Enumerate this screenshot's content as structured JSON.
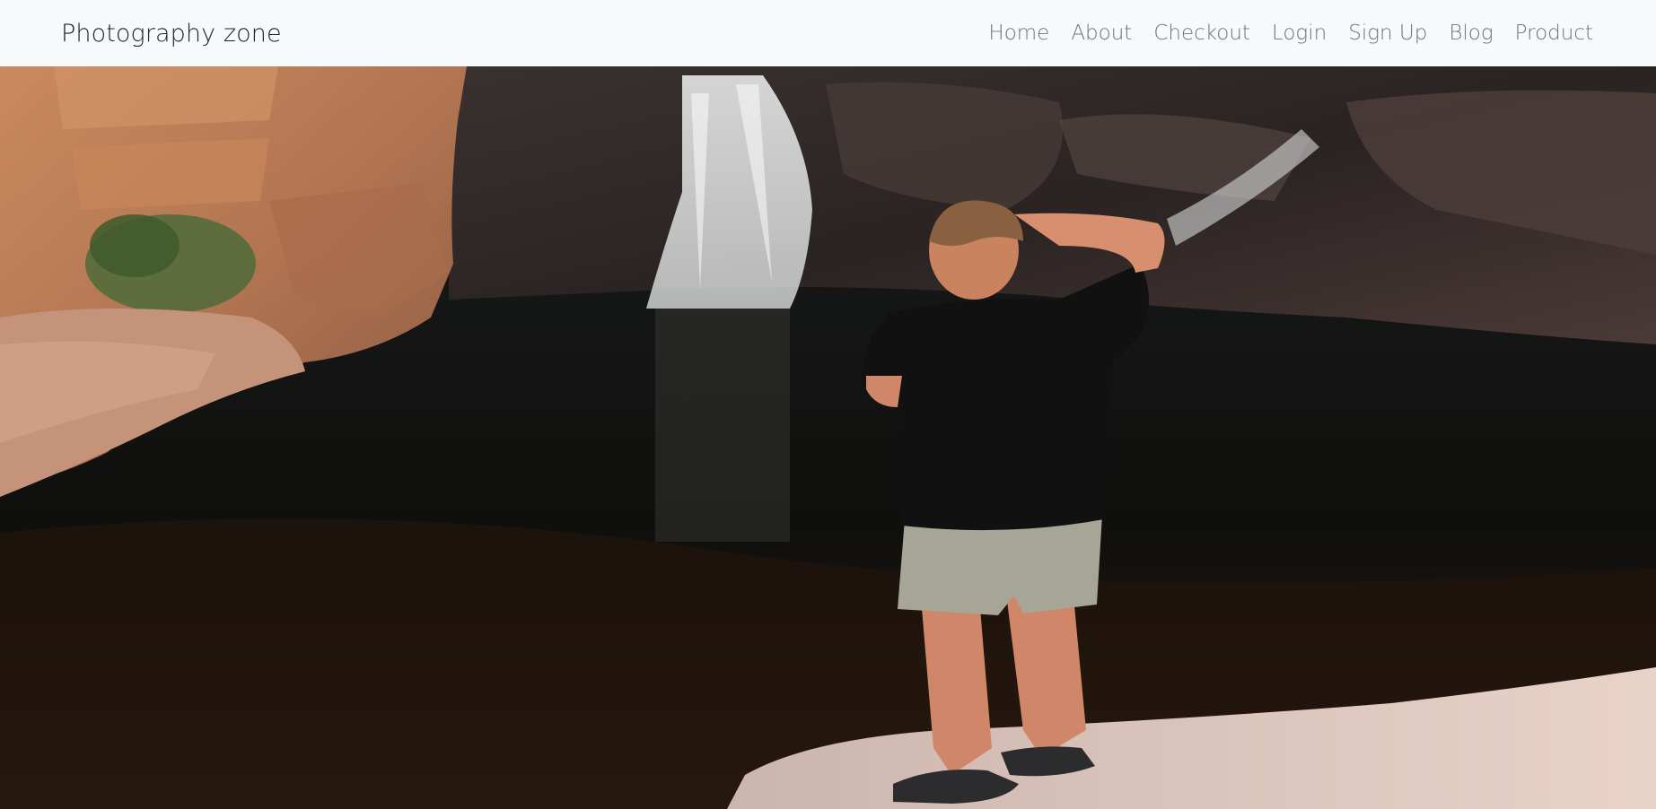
{
  "navbar": {
    "brand": "Photography zone",
    "links": [
      {
        "label": "Home"
      },
      {
        "label": "About"
      },
      {
        "label": "Checkout"
      },
      {
        "label": "Login"
      },
      {
        "label": "Sign Up"
      },
      {
        "label": "Blog"
      },
      {
        "label": "Product"
      }
    ]
  },
  "colors": {
    "navbar_bg": "#f8f9fa",
    "brand_text": "#212529",
    "link_text": "#6c757d"
  }
}
